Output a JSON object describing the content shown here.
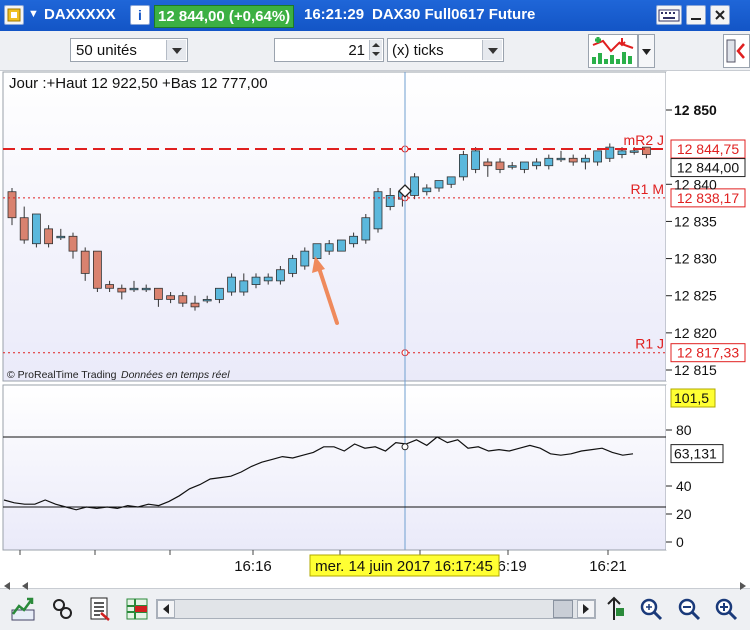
{
  "window": {
    "symbol": "DAXXXXX",
    "info_button": "i",
    "price_badge": "12 844,00 (+0,64%)",
    "time": "16:21:29",
    "instrument": "DAX30 Full0617 Future"
  },
  "toolbar": {
    "units_value": "50 unités",
    "ticks_count": "21",
    "ticks_unit": "(x) ticks"
  },
  "chart": {
    "ohlc_label": "Jour :+Haut 12 922,50 +Bas 12 777,00",
    "watermark_brand": "© ProRealTime Trading",
    "watermark_note": "Données en temps réel",
    "level_labels": [
      {
        "name": "mR2 J",
        "value": "12 844,75"
      },
      {
        "name": "R1 M",
        "value": "12 838,17"
      },
      {
        "name": "R1 J",
        "value": "12 817,33"
      }
    ],
    "current_price_label": "12 844,00",
    "price_ticks": [
      "12 850",
      "12 840",
      "12 835",
      "12 830",
      "12 825",
      "12 820",
      "12 815"
    ],
    "indicator_top_label": "101,5",
    "indicator_value_label": "63,131",
    "indicator_ticks": [
      "80",
      "40",
      "20",
      "0"
    ],
    "time_ticks": [
      "16:16",
      "16:19",
      "16:21"
    ],
    "crosshair_time_label": "mer. 14 juin 2017 16:17:45",
    "colors": {
      "up_candle": "#5bb8dc",
      "down_candle": "#d9826f",
      "level_red": "#e02020",
      "crosshair_label_bg": "#ffff33",
      "price_badge_bg": "#3cb043",
      "plot_bg": "#f3f4fc"
    }
  },
  "chart_data": {
    "type": "candlestick",
    "title": "DAX30 Full0617 Future",
    "ylim": [
      12813,
      12853
    ],
    "candles": [
      {
        "o": 12839.0,
        "h": 12839.5,
        "c": 12835.5,
        "l": 12834.5
      },
      {
        "o": 12835.5,
        "h": 12837.0,
        "c": 12832.5,
        "l": 12832.0
      },
      {
        "o": 12832.0,
        "h": 12836.0,
        "c": 12836.0,
        "l": 12831.5
      },
      {
        "o": 12834.0,
        "h": 12834.5,
        "c": 12832.0,
        "l": 12831.5
      },
      {
        "o": 12833.0,
        "h": 12834.0,
        "c": 12833.0,
        "l": 12832.5
      },
      {
        "o": 12833.0,
        "h": 12833.5,
        "c": 12831.0,
        "l": 12830.0
      },
      {
        "o": 12831.0,
        "h": 12831.5,
        "c": 12828.0,
        "l": 12827.0
      },
      {
        "o": 12831.0,
        "h": 12831.0,
        "c": 12826.0,
        "l": 12825.5
      },
      {
        "o": 12826.5,
        "h": 12827.0,
        "c": 12826.0,
        "l": 12825.5
      },
      {
        "o": 12826.0,
        "h": 12826.5,
        "c": 12825.5,
        "l": 12824.5
      },
      {
        "o": 12826.0,
        "h": 12827.0,
        "c": 12826.0,
        "l": 12825.5
      },
      {
        "o": 12826.0,
        "h": 12826.5,
        "c": 12826.0,
        "l": 12825.5
      },
      {
        "o": 12826.0,
        "h": 12826.0,
        "c": 12824.5,
        "l": 12823.5
      },
      {
        "o": 12825.0,
        "h": 12825.5,
        "c": 12824.5,
        "l": 12824.0
      },
      {
        "o": 12825.0,
        "h": 12825.5,
        "c": 12824.0,
        "l": 12823.5
      },
      {
        "o": 12824.0,
        "h": 12825.0,
        "c": 12823.5,
        "l": 12823.0
      },
      {
        "o": 12824.5,
        "h": 12825.0,
        "c": 12824.5,
        "l": 12824.0
      },
      {
        "o": 12824.5,
        "h": 12825.5,
        "c": 12826.0,
        "l": 12824.0
      },
      {
        "o": 12825.5,
        "h": 12828.0,
        "c": 12827.5,
        "l": 12825.0
      },
      {
        "o": 12825.5,
        "h": 12828.0,
        "c": 12827.0,
        "l": 12825.0
      },
      {
        "o": 12826.5,
        "h": 12828.0,
        "c": 12827.5,
        "l": 12826.0
      },
      {
        "o": 12827.0,
        "h": 12828.0,
        "c": 12827.5,
        "l": 12826.5
      },
      {
        "o": 12827.0,
        "h": 12829.0,
        "c": 12828.5,
        "l": 12826.5
      },
      {
        "o": 12828.0,
        "h": 12830.5,
        "c": 12830.0,
        "l": 12827.5
      },
      {
        "o": 12829.0,
        "h": 12831.5,
        "c": 12831.0,
        "l": 12828.5
      },
      {
        "o": 12830.0,
        "h": 12832.0,
        "c": 12832.0,
        "l": 12829.5
      },
      {
        "o": 12831.0,
        "h": 12832.5,
        "c": 12832.0,
        "l": 12830.5
      },
      {
        "o": 12831.0,
        "h": 12832.5,
        "c": 12832.5,
        "l": 12831.0
      },
      {
        "o": 12832.0,
        "h": 12833.5,
        "c": 12833.0,
        "l": 12831.5
      },
      {
        "o": 12832.5,
        "h": 12836.0,
        "c": 12835.5,
        "l": 12832.0
      },
      {
        "o": 12834.0,
        "h": 12839.5,
        "c": 12839.0,
        "l": 12833.5
      },
      {
        "o": 12837.0,
        "h": 12839.5,
        "c": 12838.5,
        "l": 12836.5
      },
      {
        "o": 12838.0,
        "h": 12839.5,
        "c": 12839.0,
        "l": 12837.0
      },
      {
        "o": 12838.5,
        "h": 12841.5,
        "c": 12841.0,
        "l": 12838.0
      },
      {
        "o": 12839.0,
        "h": 12840.0,
        "c": 12839.5,
        "l": 12838.5
      },
      {
        "o": 12839.5,
        "h": 12840.5,
        "c": 12840.5,
        "l": 12839.0
      },
      {
        "o": 12840.0,
        "h": 12841.0,
        "c": 12841.0,
        "l": 12839.5
      },
      {
        "o": 12841.0,
        "h": 12844.5,
        "c": 12844.0,
        "l": 12840.5
      },
      {
        "o": 12842.0,
        "h": 12845.0,
        "c": 12844.5,
        "l": 12841.5
      },
      {
        "o": 12843.0,
        "h": 12843.5,
        "c": 12842.5,
        "l": 12841.0
      },
      {
        "o": 12843.0,
        "h": 12843.5,
        "c": 12842.0,
        "l": 12841.5
      },
      {
        "o": 12842.5,
        "h": 12843.0,
        "c": 12842.5,
        "l": 12842.0
      },
      {
        "o": 12842.0,
        "h": 12843.0,
        "c": 12843.0,
        "l": 12841.5
      },
      {
        "o": 12842.5,
        "h": 12843.5,
        "c": 12843.0,
        "l": 12842.0
      },
      {
        "o": 12842.5,
        "h": 12844.0,
        "c": 12843.5,
        "l": 12842.0
      },
      {
        "o": 12843.5,
        "h": 12844.5,
        "c": 12843.5,
        "l": 12843.0
      },
      {
        "o": 12843.5,
        "h": 12844.0,
        "c": 12843.0,
        "l": 12842.5
      },
      {
        "o": 12843.0,
        "h": 12844.0,
        "c": 12843.5,
        "l": 12842.0
      },
      {
        "o": 12843.0,
        "h": 12844.5,
        "c": 12844.5,
        "l": 12842.5
      },
      {
        "o": 12843.5,
        "h": 12845.5,
        "c": 12845.0,
        "l": 12843.0
      },
      {
        "o": 12844.0,
        "h": 12845.0,
        "c": 12844.5,
        "l": 12843.5
      },
      {
        "o": 12844.5,
        "h": 12845.0,
        "c": 12844.5,
        "l": 12844.0
      },
      {
        "o": 12845.0,
        "h": 12845.0,
        "c": 12844.0,
        "l": 12843.5
      }
    ],
    "levels": [
      {
        "name": "mR2 J",
        "value": 12844.75,
        "style": "dashed"
      },
      {
        "name": "R1 M",
        "value": 12838.17,
        "style": "dotted"
      },
      {
        "name": "R1 J",
        "value": 12817.33,
        "style": "dotted"
      }
    ],
    "indicator": {
      "ylim": [
        -5,
        101.5
      ],
      "bands": [
        75,
        25
      ],
      "values": [
        30,
        28,
        27,
        27,
        30,
        27,
        25,
        23,
        25,
        24,
        25,
        24,
        26,
        25,
        27,
        26,
        29,
        33,
        38,
        41,
        45,
        46,
        47,
        50,
        54,
        57,
        59,
        61,
        60,
        62,
        64,
        68,
        68,
        65,
        70,
        67,
        68,
        65,
        71,
        70,
        73,
        69,
        75,
        71,
        73,
        67,
        68,
        65,
        66,
        65,
        67,
        69,
        67,
        63,
        62,
        63,
        65,
        66,
        67,
        64,
        62,
        63
      ]
    }
  }
}
